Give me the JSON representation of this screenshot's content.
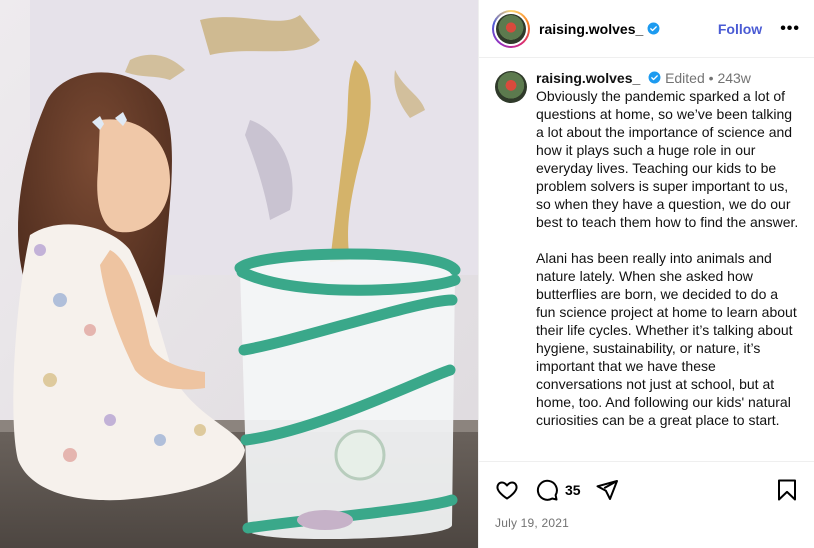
{
  "post": {
    "username": "raising.wolves_",
    "follow_label": "Follow",
    "more_label": "•••"
  },
  "caption": {
    "username": "raising.wolves_",
    "edited_label": "Edited",
    "separator": "•",
    "age": "243w",
    "paragraph_1": "Obviously the pandemic sparked a lot of questions at home, so we’ve been talking a lot about the importance of science and how it plays such a huge role in our everyday lives. Teaching our kids to be problem solvers is super important to us, so when they have a question, we do our best to teach them how to find the answer.",
    "paragraph_2": "Alani has been really into animals and nature lately. When she asked how butterflies are born, we decided to do a fun science project at home to learn about their life cycles. Whether it’s talking about hygiene, sustainability, or nature, it’s important that we have these conversations not just at school, but at home, too. And following our kids' natural curiosities can be a great place to start."
  },
  "actions": {
    "comment_count": "35",
    "date": "July 19, 2021",
    "icons": [
      "heart-icon",
      "comment-icon",
      "share-icon",
      "bookmark-icon"
    ]
  },
  "colors": {
    "follow": "#4a5bd4",
    "verified": "#1d9bf0",
    "meta": "#737373"
  }
}
